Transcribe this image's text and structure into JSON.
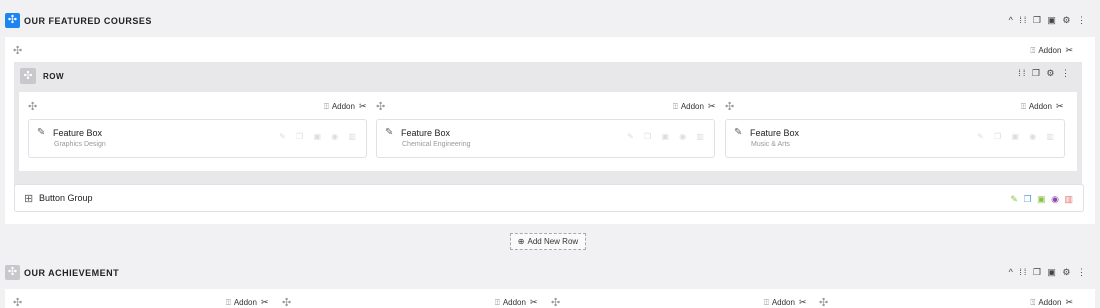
{
  "sections": {
    "featured": {
      "title": "OUR FEATURED COURSES",
      "move_icon": "✣",
      "tools": "^ ⁞⁞ ❐ ▣ ⚙ ⋮"
    },
    "achievement": {
      "title": "OUR ACHIEVEMENT",
      "move_icon": "✣",
      "tools": "^ ⁞⁞ ❐ ▣ ⚙ ⋮"
    }
  },
  "row": {
    "title": "ROW",
    "move_icon": "✣",
    "tools": "⁞⁞ ❐ ⚙ ⋮"
  },
  "addon": {
    "label": "Addon",
    "icon": "⍐",
    "wrench": "✂"
  },
  "feature_boxes": [
    {
      "title": "Feature Box",
      "subtitle": "Graphics Design"
    },
    {
      "title": "Feature Box",
      "subtitle": "Chemical Engineering"
    },
    {
      "title": "Feature Box",
      "subtitle": "Music & Arts"
    }
  ],
  "feature_icon": "✎",
  "feature_tools": "✎ ❐ ▣ ◉ ▥",
  "button_group": {
    "label": "Button Group",
    "icon": "⊞",
    "tools": [
      "✎",
      "❐",
      "▣",
      "◉",
      "▥"
    ],
    "tool_colors": [
      "#8bc34a",
      "#5b9bd5",
      "#8bc34a",
      "#8e44ad",
      "#e57373"
    ]
  },
  "add_new_row": {
    "label": "Add New Row",
    "icon": "⊕"
  },
  "move_icon": "✣"
}
